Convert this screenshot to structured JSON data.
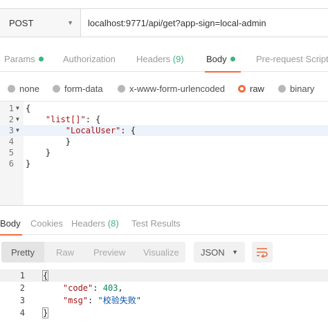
{
  "request": {
    "method": "POST",
    "url": "localhost:9771/api/get?app-sign=local-admin"
  },
  "request_tabs": {
    "params": "Params",
    "authorization": "Authorization",
    "headers": "Headers",
    "headers_count": "(9)",
    "body": "Body",
    "prerequest": "Pre-request Script"
  },
  "body_types": {
    "none": "none",
    "form_data": "form-data",
    "urlencoded": "x-www-form-urlencoded",
    "raw": "raw",
    "binary": "binary",
    "selected": "raw"
  },
  "request_body": {
    "line_numbers": [
      "1",
      "2",
      "3",
      "4",
      "5",
      "6"
    ],
    "line1": "{",
    "line2_key": "\"list[]\"",
    "line2_rest": ": {",
    "line3_key": "\"LocalUser\"",
    "line3_rest": ": {",
    "line4": "}",
    "line5": "}",
    "line6": "}"
  },
  "response_tabs": {
    "body": "Body",
    "cookies": "Cookies",
    "headers": "Headers",
    "headers_count": "(8)",
    "test_results": "Test Results"
  },
  "view_modes": {
    "pretty": "Pretty",
    "raw": "Raw",
    "preview": "Preview",
    "visualize": "Visualize",
    "format": "JSON"
  },
  "response_body": {
    "line_numbers": [
      "1",
      "2",
      "3",
      "4"
    ],
    "line1": "{",
    "code_key": "\"code\"",
    "code_value": "403",
    "msg_key": "\"msg\"",
    "msg_value": "\"校验失败\"",
    "line4": "}"
  },
  "colors": {
    "accent": "#f26b3a",
    "indicator": "#3fb37f"
  },
  "icons": {
    "wrap": "wrap-lines-icon",
    "fold": "fold-arrow-icon",
    "dropdown": "chevron-down-icon"
  }
}
